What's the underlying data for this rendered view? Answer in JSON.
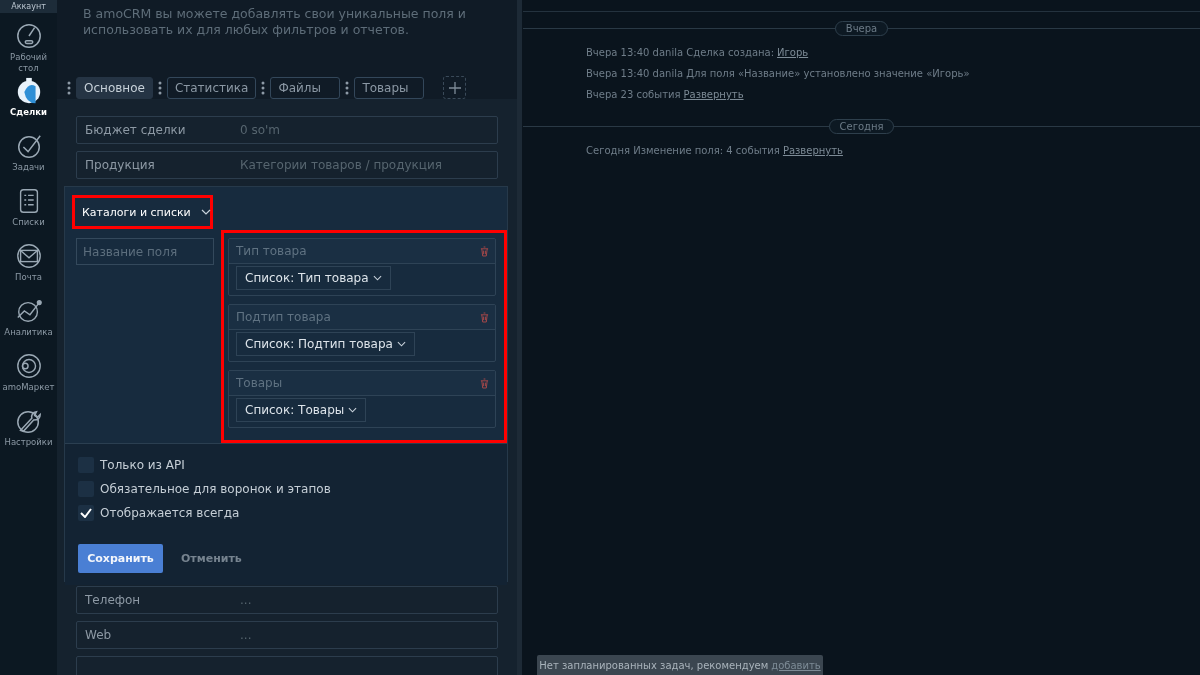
{
  "sidebar": {
    "account_label": "Аккаунт",
    "items": [
      {
        "label": "Рабочий стол",
        "selected": false
      },
      {
        "label": "Сделки",
        "selected": true
      },
      {
        "label": "Задачи",
        "selected": false
      },
      {
        "label": "Списки",
        "selected": false
      },
      {
        "label": "Почта",
        "selected": false
      },
      {
        "label": "Аналитика",
        "selected": false
      },
      {
        "label": "amoМаркет",
        "selected": false
      },
      {
        "label": "Настройки",
        "selected": false
      }
    ]
  },
  "intro": "В amoCRM вы можете добавлять свои уникальные поля и использовать их для любых фильтров и отчетов.",
  "tabs": [
    {
      "label": "Основное",
      "selected": true
    },
    {
      "label": "Статистика",
      "selected": false
    },
    {
      "label": "Файлы",
      "selected": false
    },
    {
      "label": "Товары",
      "selected": false
    }
  ],
  "fields": [
    {
      "label": "Бюджет сделки",
      "value": "0 so'm"
    },
    {
      "label": "Продукция",
      "value": "Категории товаров / продукция"
    }
  ],
  "fields_below": [
    {
      "label": "Телефон",
      "value": "..."
    },
    {
      "label": "Web",
      "value": "..."
    }
  ],
  "editor": {
    "type_select": "Каталоги и списки",
    "name_placeholder": "Название поля",
    "lists": [
      {
        "name": "Тип товара",
        "select": "Список: Тип товара"
      },
      {
        "name": "Подтип товара",
        "select": "Список: Подтип товара"
      },
      {
        "name": "Товары",
        "select": "Список: Товары"
      }
    ],
    "options": [
      {
        "label": "Только из API",
        "checked": false
      },
      {
        "label": "Обязательное для воронок и этапов",
        "checked": false
      },
      {
        "label": "Отображается всегда",
        "checked": true
      }
    ],
    "save": "Сохранить",
    "cancel": "Отменить"
  },
  "timeline": [
    {
      "kind": "separator",
      "label": "Вчера"
    },
    {
      "kind": "event",
      "text": "Вчера 13:40 danila Сделка создана:",
      "link": "Игорь"
    },
    {
      "kind": "event",
      "text": "Вчера 13:40 danila Для поля «Название» установлено значение «Игорь»"
    },
    {
      "kind": "event",
      "text": "Вчера 23 события",
      "link": "Развернуть"
    },
    {
      "kind": "separator",
      "label": "Сегодня"
    },
    {
      "kind": "event",
      "text": "Сегодня Изменение поля: 4 события",
      "link": "Развернуть"
    }
  ],
  "notice": {
    "text": "Нет запланированных задач, рекомендуем",
    "link": "добавить"
  }
}
